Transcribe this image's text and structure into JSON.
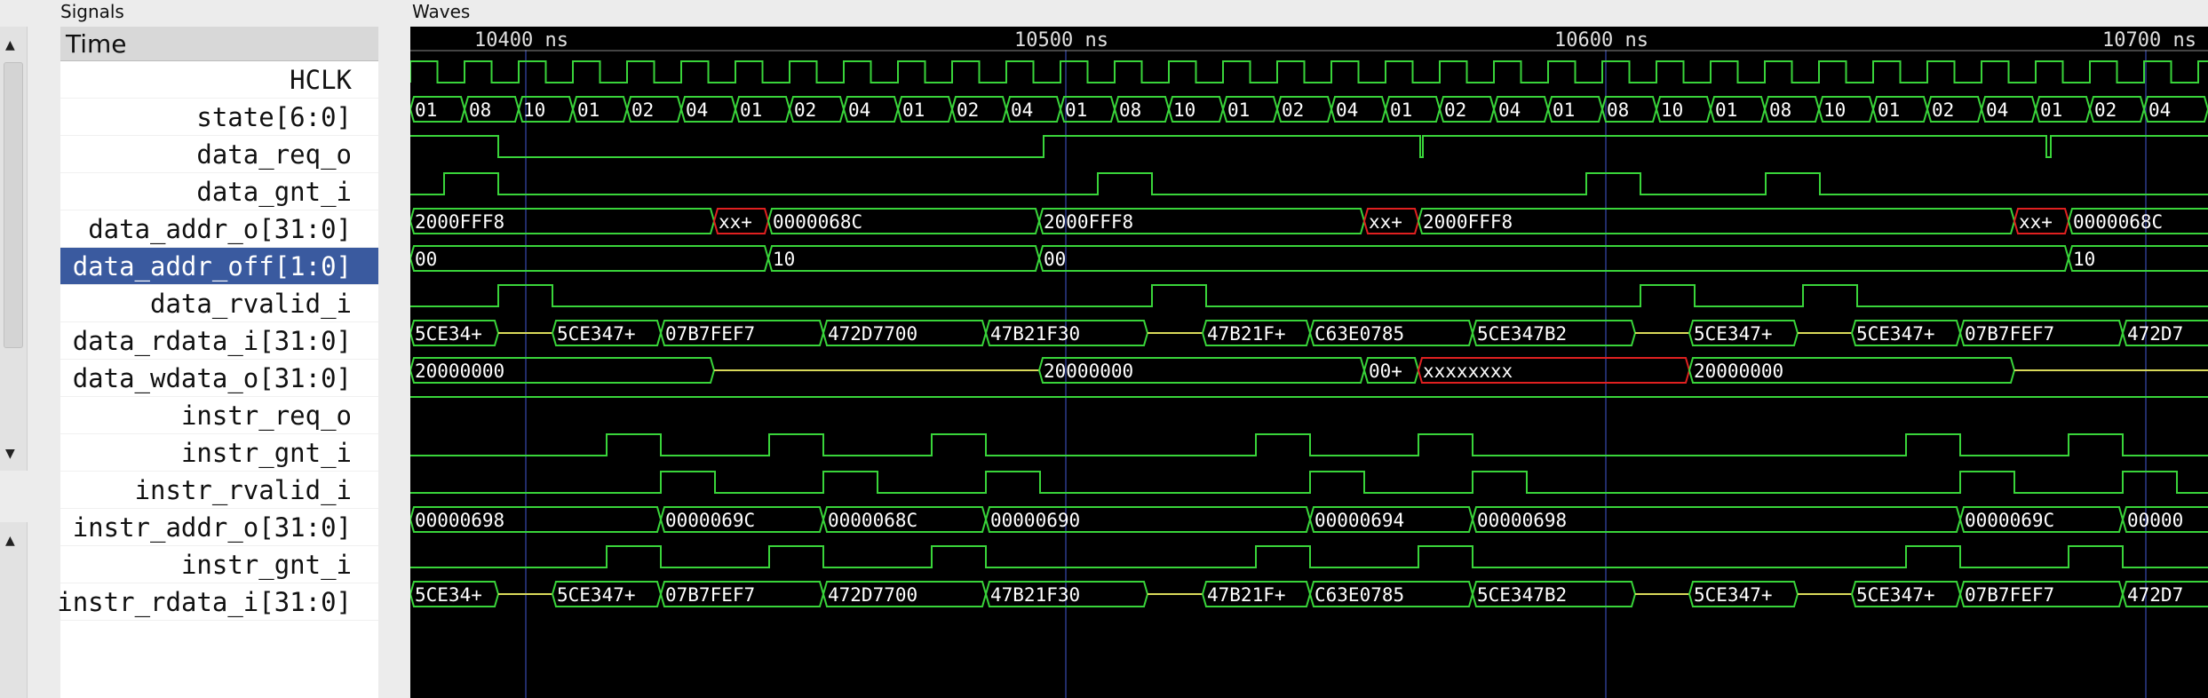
{
  "panels": {
    "signals_title": "Signals",
    "waves_title": "Waves"
  },
  "signals_header": "Time",
  "signals": [
    "HCLK",
    "state[6:0]",
    "data_req_o",
    "data_gnt_i",
    "data_addr_o[31:0]",
    "data_addr_off[1:0]",
    "data_rvalid_i",
    "data_rdata_i[31:0]",
    "data_wdata_o[31:0]",
    "instr_req_o",
    "instr_gnt_i",
    "instr_rvalid_i",
    "instr_addr_o[31:0]",
    "instr_gnt_i",
    "instr_rdata_i[31:0]"
  ],
  "selected_signal": "data_addr_off[1:0]",
  "time_markers": [
    "10400 ns",
    "10500 ns",
    "10600 ns",
    "10700 ns"
  ],
  "colors": {
    "wave": "#39d43a",
    "undefined": "#e02020",
    "tristate": "#d9d95a",
    "marker": "#2c3a8a",
    "select": "#3a5a9f"
  },
  "waves": {
    "state": [
      "01",
      "08",
      "10",
      "01",
      "02",
      "04",
      "01",
      "02",
      "04",
      "01",
      "02",
      "04",
      "01",
      "08",
      "10",
      "01",
      "02",
      "04",
      "01",
      "02",
      "04",
      "01",
      "08",
      "10",
      "01",
      "08",
      "10",
      "01",
      "02",
      "04",
      "01",
      "02",
      "04"
    ],
    "data_req_o": [
      [
        0,
        1
      ],
      [
        1,
        0
      ],
      [
        12,
        1
      ],
      [
        19,
        0
      ],
      [
        19,
        1
      ],
      [
        23,
        0
      ],
      [
        23,
        1
      ],
      [
        25,
        0
      ]
    ],
    "data_addr_o": [
      {
        "t": "2000FFF8"
      },
      {
        "t": "xx+",
        "x": true
      },
      {
        "t": "0000068C"
      },
      {
        "t": "2000FFF8"
      },
      {
        "t": "xx+",
        "x": true
      },
      {
        "t": "2000FFF8"
      },
      {
        "t": "xx+",
        "x": true
      },
      {
        "t": "0000068C"
      }
    ],
    "data_addr_off": [
      "00",
      "10",
      "00",
      "10"
    ],
    "data_rdata_i": [
      "5CE34+",
      "5CE347+",
      "07B7FEF7",
      "472D7700",
      "47B21F30",
      "47B21F+",
      "C63E0785",
      "5CE347B2",
      "5CE347+",
      "5CE347+",
      "07B7FEF7",
      "472D7"
    ],
    "data_wdata_o": [
      {
        "t": "20000000"
      },
      {
        "t": "20000000"
      },
      {
        "t": "00+"
      },
      {
        "t": "xxxxxxxx",
        "x": true
      },
      {
        "t": "20000000"
      }
    ],
    "instr_addr_o": [
      "00000698",
      "0000069C",
      "0000068C",
      "00000690",
      "00000694",
      "00000698",
      "0000069C",
      "00000"
    ],
    "instr_rdata_i": [
      "5CE34+",
      "5CE347+",
      "07B7FEF7",
      "472D7700",
      "47B21F30",
      "47B21F+",
      "C63E0785",
      "5CE347B2",
      "5CE347+",
      "5CE347+",
      "07B7FEF7",
      "472D7"
    ]
  }
}
